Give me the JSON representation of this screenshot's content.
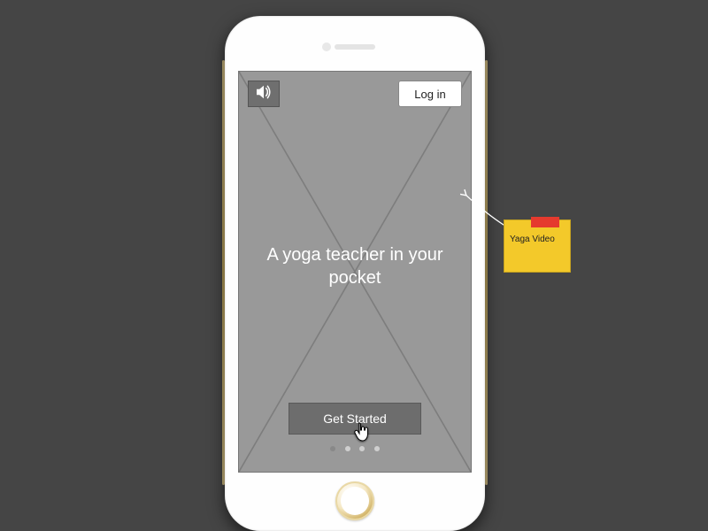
{
  "header": {
    "login_label": "Log in"
  },
  "body": {
    "headline": "A yoga teacher in your pocket"
  },
  "cta": {
    "get_started_label": "Get Started"
  },
  "annotation": {
    "sticky_text": "Yaga Video"
  },
  "page_dots": {
    "count": 4,
    "active_index": 0
  }
}
